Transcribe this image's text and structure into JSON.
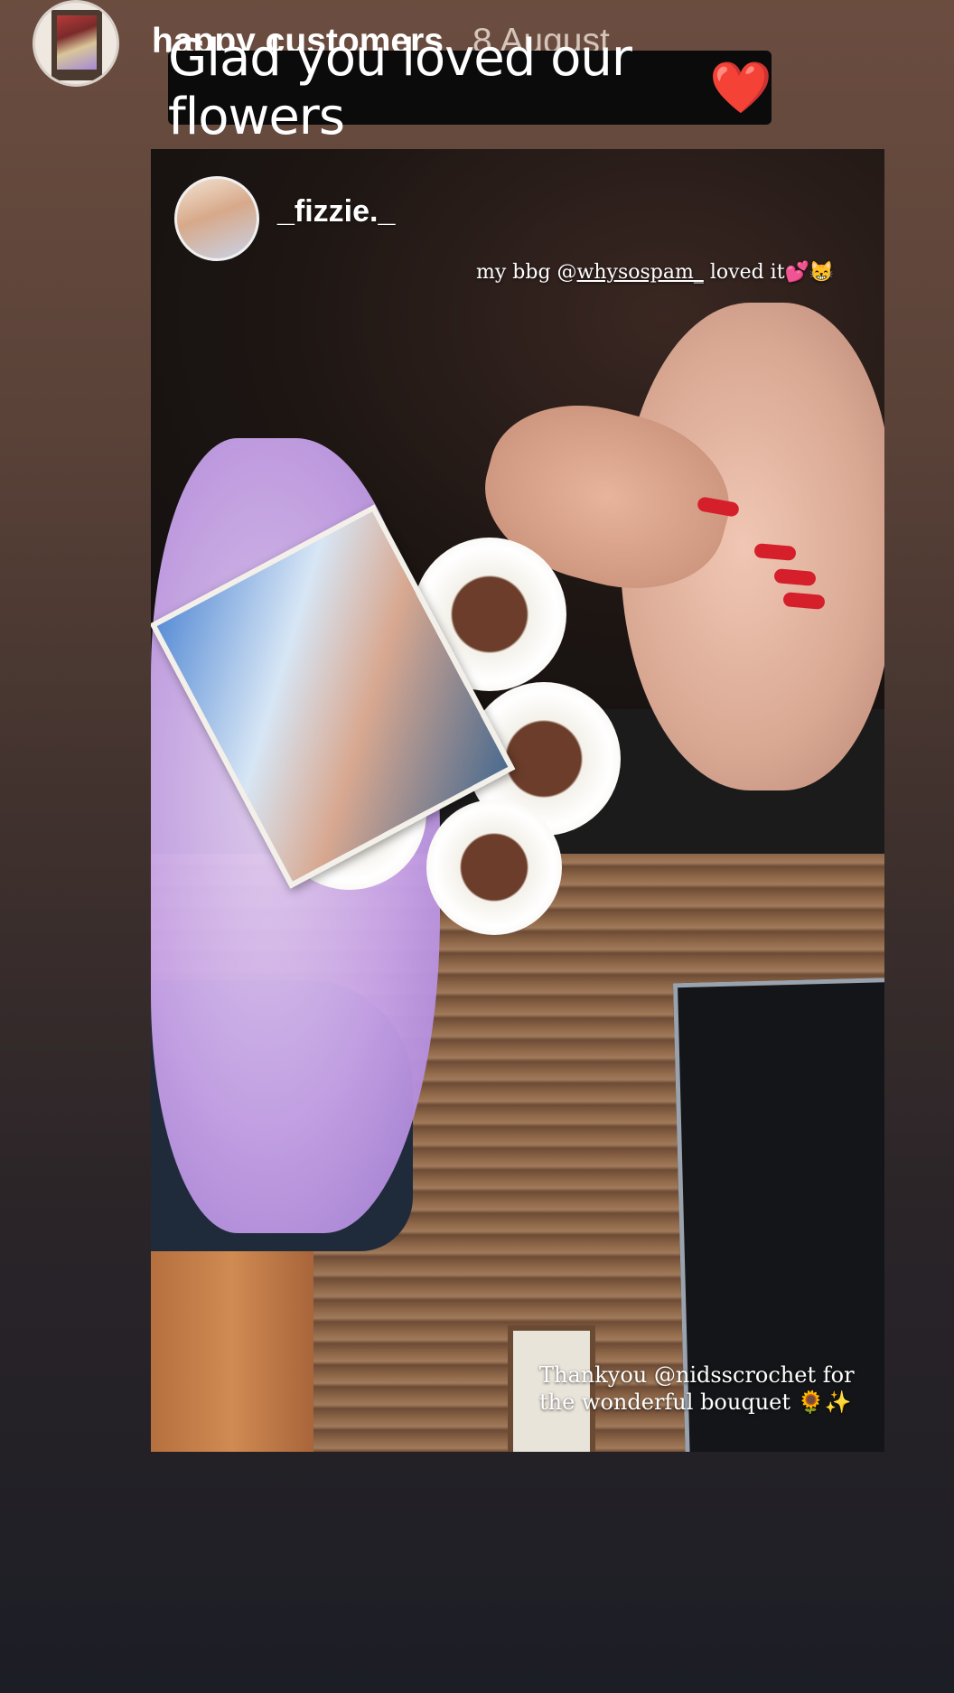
{
  "header": {
    "account_name": "happy customers",
    "time": "8 August",
    "caption": "Glad you loved our flowers",
    "caption_emoji": "❤️"
  },
  "story": {
    "poster_username": "_fizzie._",
    "top_caption_prefix": "my bbg @",
    "top_caption_mention": "whysospam_",
    "top_caption_suffix": " loved it💕😸",
    "bottom_caption": "Thankyou @nidsscrochet for the wonderful bouquet 🌻✨"
  },
  "colors": {
    "background_top": "#6b4d40",
    "background_bottom": "#1c1e25",
    "caption_bg": "#0b0b0b",
    "heart": "#e02424"
  }
}
